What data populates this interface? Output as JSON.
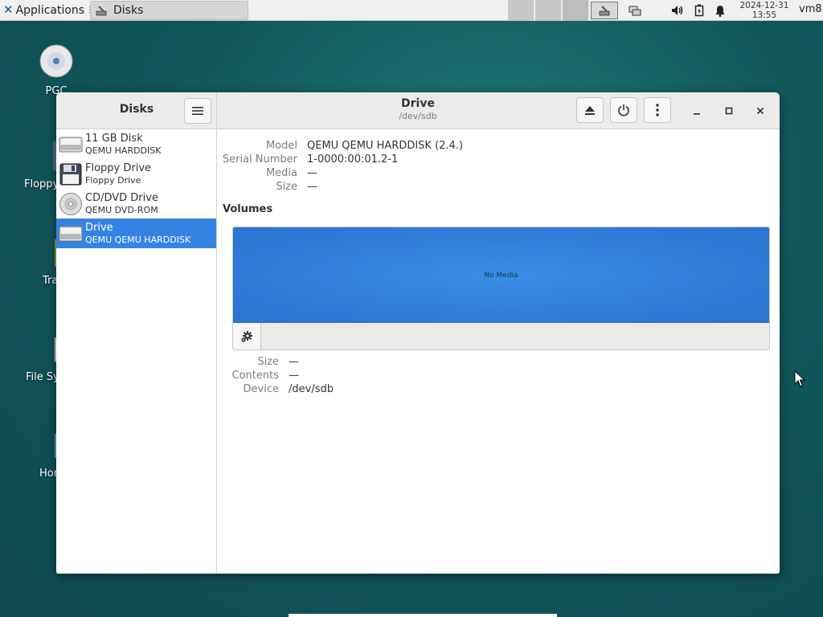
{
  "panel": {
    "applications_label": "Applications",
    "window_button_label": "Disks",
    "clock_date": "2024-12-31",
    "clock_time": "13:55",
    "user": "vm8"
  },
  "desktop": {
    "icons": [
      {
        "label": "PGC"
      },
      {
        "label": "Floppy"
      },
      {
        "label": "Tra"
      },
      {
        "label": "File Sy"
      },
      {
        "label": "Hor"
      }
    ]
  },
  "window": {
    "sidebar_title": "Disks",
    "title": "Drive",
    "subtitle": "/dev/sdb",
    "drives": [
      {
        "name": "11 GB Disk",
        "sub": "QEMU HARDDISK",
        "icon": "harddisk-icon"
      },
      {
        "name": "Floppy Drive",
        "sub": "Floppy Drive",
        "icon": "floppy-icon"
      },
      {
        "name": "CD/DVD Drive",
        "sub": "QEMU DVD-ROM",
        "icon": "optical-disc-icon"
      },
      {
        "name": "Drive",
        "sub": "QEMU QEMU HARDDISK",
        "icon": "harddisk-icon"
      }
    ],
    "details": {
      "model_label": "Model",
      "model_value": "QEMU QEMU HARDDISK (2.4.)",
      "serial_label": "Serial Number",
      "serial_value": "1-0000:00:01.2-1",
      "media_label": "Media",
      "media_value": "—",
      "size_label": "Size",
      "size_value": "—"
    },
    "volumes": {
      "heading": "Volumes",
      "bar_label": "No Media",
      "size_label": "Size",
      "size_value": "—",
      "contents_label": "Contents",
      "contents_value": "—",
      "device_label": "Device",
      "device_value": "/dev/sdb"
    }
  },
  "colors": {
    "selection": "#3584e4",
    "volume_bar": "#2b73d0",
    "desktop": "#11585b"
  }
}
